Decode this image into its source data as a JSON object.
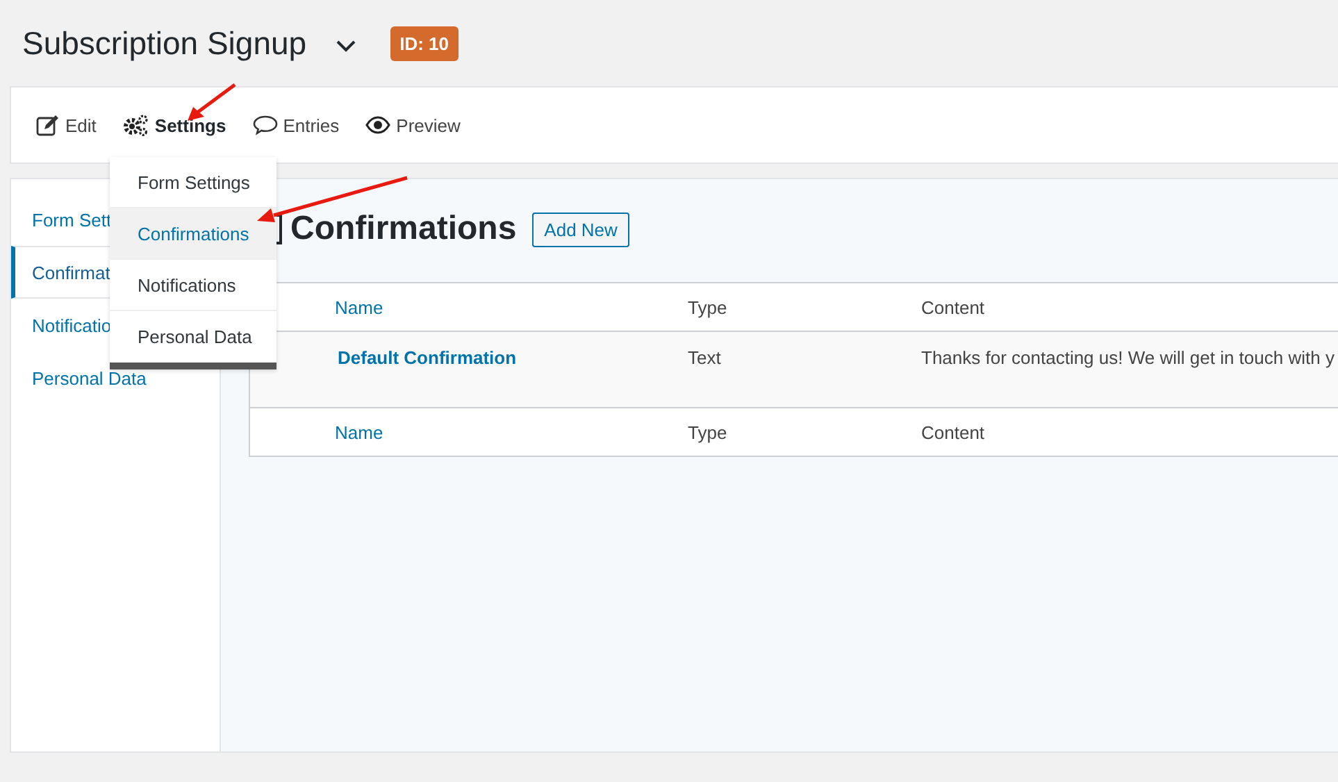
{
  "header": {
    "title": "Subscription Signup",
    "badge": "ID: 10"
  },
  "toolbar": [
    {
      "kind": "edit",
      "label": "Edit",
      "selected": false
    },
    {
      "kind": "settings",
      "label": "Settings",
      "selected": true
    },
    {
      "kind": "entries",
      "label": "Entries",
      "selected": false
    },
    {
      "kind": "preview",
      "label": "Preview",
      "selected": false
    }
  ],
  "dropdown": [
    {
      "label": "Form Settings",
      "selected": false
    },
    {
      "label": "Confirmations",
      "selected": true
    },
    {
      "label": "Notifications",
      "selected": false
    },
    {
      "label": "Personal Data",
      "selected": false
    }
  ],
  "sidebar": {
    "items": [
      {
        "label": "Form Sett",
        "selected": false
      },
      {
        "label": "Confirmat",
        "selected": true
      },
      {
        "label": "Notificatio",
        "selected": false
      },
      {
        "label": "Personal Data",
        "selected": false
      }
    ]
  },
  "main": {
    "heading": "Confirmations",
    "add_button": "Add New"
  },
  "table": {
    "columns": [
      "Name",
      "Type",
      "Content"
    ],
    "rows": [
      {
        "name": "Default Confirmation",
        "type": "Text",
        "content": "Thanks for contacting us! We will get in touch with y"
      }
    ],
    "footer": [
      "Name",
      "Type",
      "Content"
    ]
  }
}
